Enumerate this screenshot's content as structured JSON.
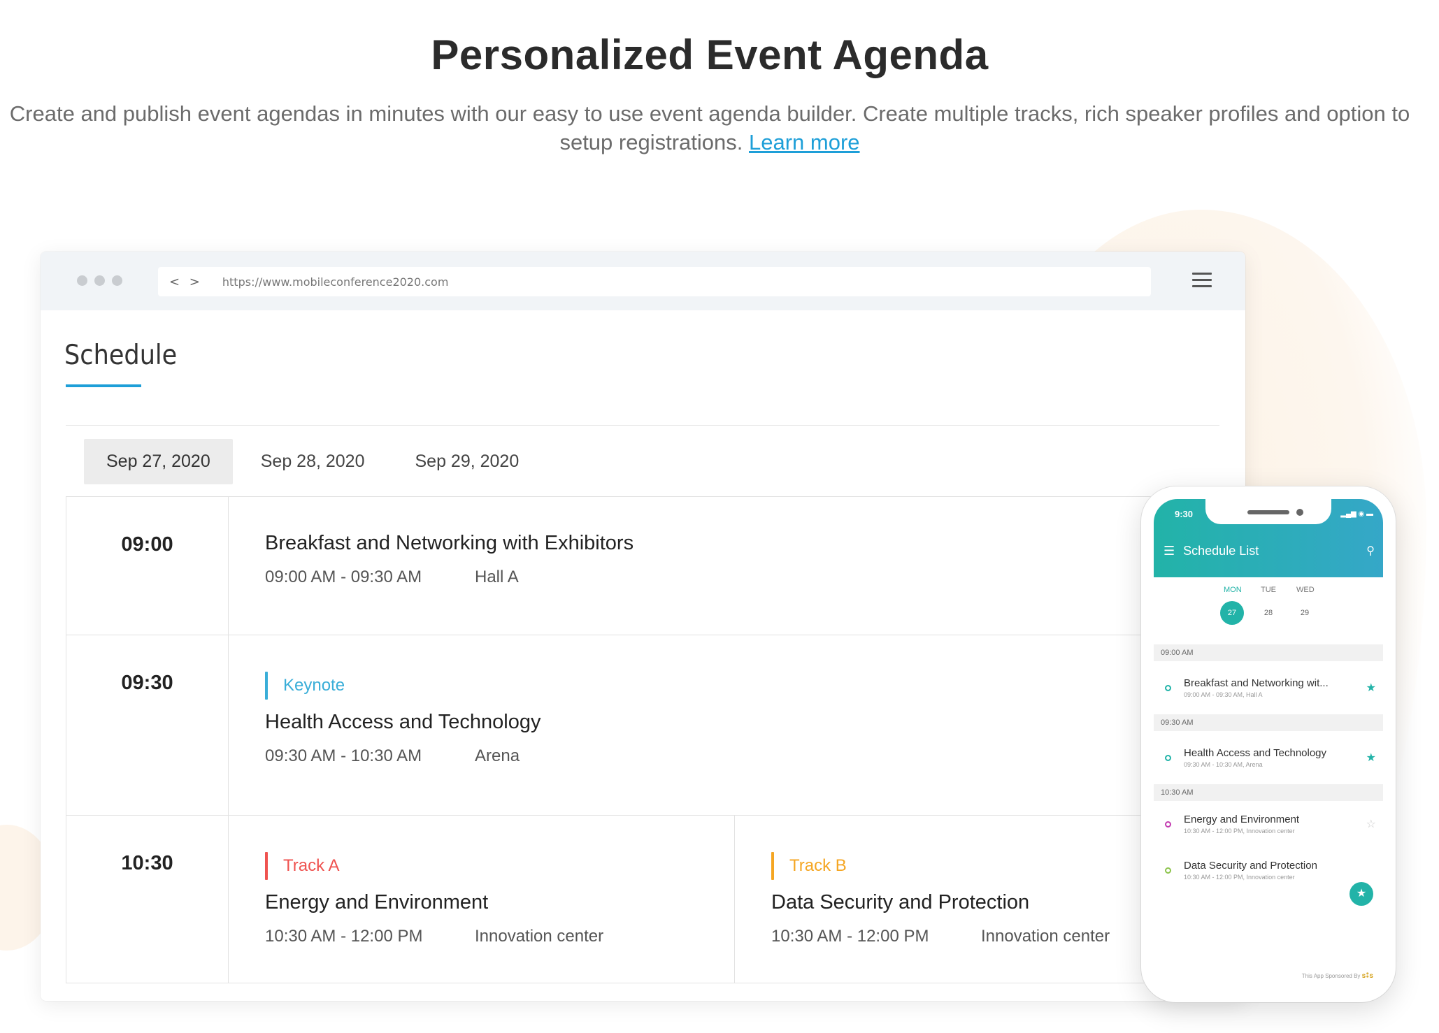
{
  "hero": {
    "title": "Personalized Event Agenda",
    "description": "Create and publish event agendas in minutes with our easy to use event agenda builder. Create multiple tracks, rich speaker profiles and option to setup registrations.",
    "learn_more": "Learn more"
  },
  "browser": {
    "nav_arrows": "< >",
    "url": "https://www.mobileconference2020.com"
  },
  "schedule": {
    "title": "Schedule",
    "dates": [
      "Sep 27, 2020",
      "Sep 28, 2020",
      "Sep 29, 2020"
    ],
    "active_date": "Sep 27, 2020",
    "rows": [
      {
        "time": "09:00",
        "sessions": [
          {
            "track": "",
            "title": "Breakfast and Networking with Exhibitors",
            "time": "09:00 AM - 09:30 AM",
            "location": "Hall A"
          }
        ]
      },
      {
        "time": "09:30",
        "sessions": [
          {
            "track": "Keynote",
            "track_color": "#3aaed8",
            "title": "Health Access and Technology",
            "time": "09:30 AM - 10:30 AM",
            "location": "Arena"
          }
        ]
      },
      {
        "time": "10:30",
        "sessions": [
          {
            "track": "Track A",
            "track_color": "#ef5350",
            "title": "Energy and Environment",
            "time": "10:30 AM - 12:00 PM",
            "location": "Innovation center"
          },
          {
            "track": "Track B",
            "track_color": "#f5a623",
            "title": "Data Security and Protection",
            "time": "10:30 AM - 12:00 PM",
            "location": "Innovation center"
          }
        ]
      }
    ]
  },
  "phone": {
    "status_time": "9:30",
    "title": "Schedule List",
    "days": [
      "MON",
      "TUE",
      "WED"
    ],
    "dates": [
      "27",
      "28",
      "29"
    ],
    "sections": [
      {
        "label": "09:00 AM",
        "items": [
          {
            "title": "Breakfast and Networking wit...",
            "sub": "09:00 AM - 09:30 AM, Hall A",
            "starred": true
          }
        ]
      },
      {
        "label": "09:30 AM",
        "items": [
          {
            "title": "Health Access and Technology",
            "sub": "09:30 AM - 10:30 AM, Arena",
            "starred": true
          }
        ]
      },
      {
        "label": "10:30 AM",
        "items": [
          {
            "title": "Energy and Environment",
            "sub": "10:30 AM - 12:00 PM, Innovation center",
            "starred": false
          },
          {
            "title": "Data Security and Protection",
            "sub": "10:30 AM - 12:00 PM, Innovation center",
            "starred": false
          }
        ]
      }
    ],
    "footer_text": "This App Sponsored By",
    "footer_brand": "s⁑s"
  },
  "colors": {
    "accent": "#1e9fd8",
    "phone_accent": "#22b3a8"
  }
}
